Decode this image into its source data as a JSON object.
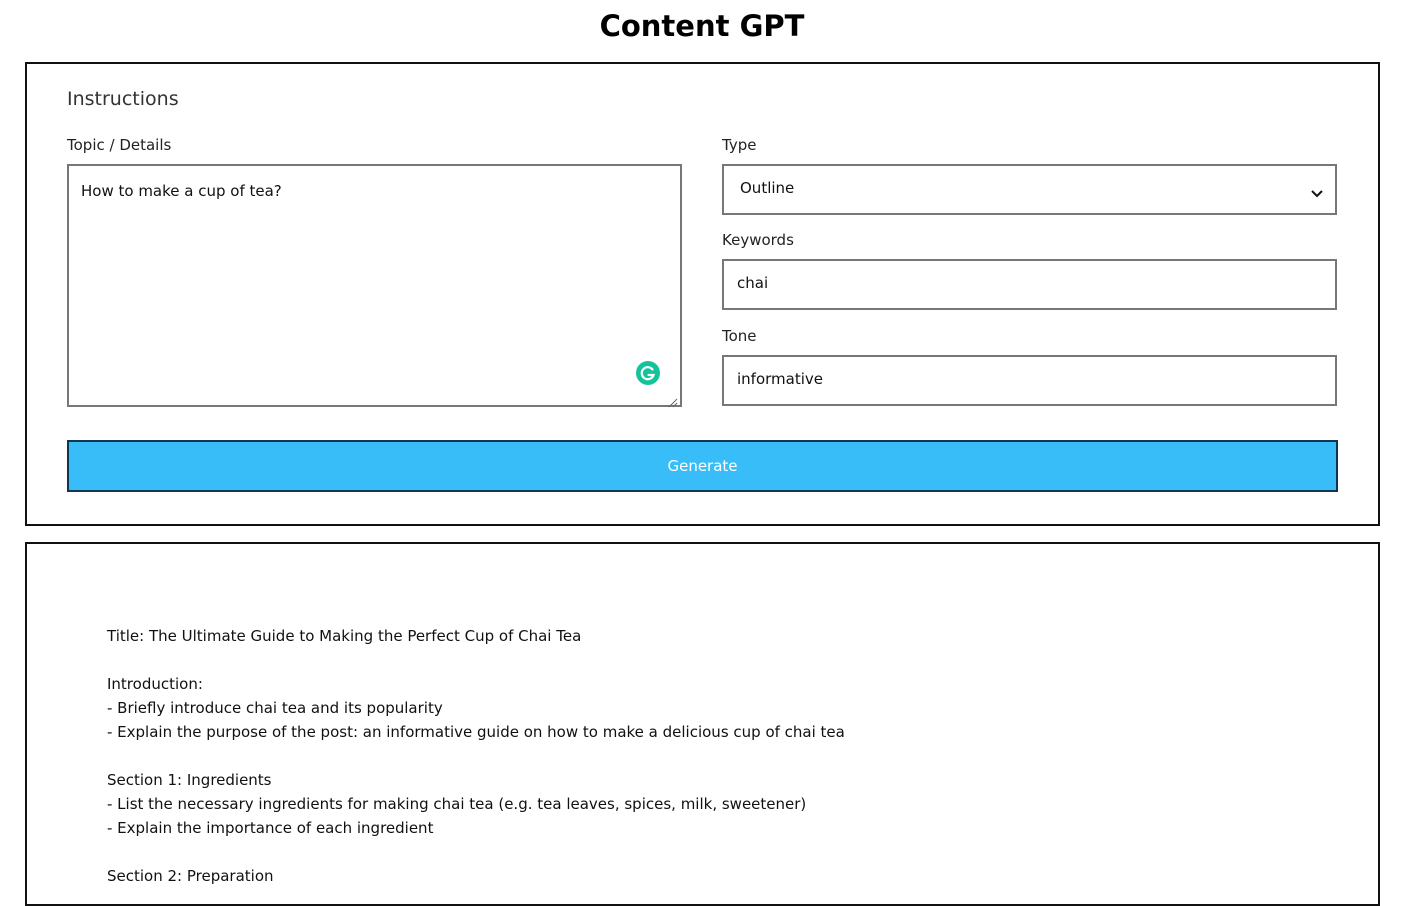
{
  "app": {
    "title": "Content GPT"
  },
  "instructions": {
    "heading": "Instructions",
    "topic": {
      "label": "Topic / Details",
      "value": "How to make a cup of tea?"
    },
    "type": {
      "label": "Type",
      "selected": "Outline"
    },
    "keywords": {
      "label": "Keywords",
      "value": "chai"
    },
    "tone": {
      "label": "Tone",
      "value": "informative"
    },
    "generate_label": "Generate"
  },
  "output": {
    "lines": [
      "Title: The Ultimate Guide to Making the Perfect Cup of Chai Tea",
      "",
      "Introduction:",
      "- Briefly introduce chai tea and its popularity",
      "- Explain the purpose of the post: an informative guide on how to make a delicious cup of chai tea",
      "",
      "Section 1: Ingredients",
      "- List the necessary ingredients for making chai tea (e.g. tea leaves, spices, milk, sweetener)",
      "- Explain the importance of each ingredient",
      "",
      "Section 2: Preparation"
    ]
  },
  "colors": {
    "accent": "#38bdf8",
    "accent_border": "#0f3550",
    "grammarly": "#15c39a"
  },
  "icons": [
    "grammarly-icon",
    "resize-handle-icon",
    "chevron-down-icon"
  ]
}
